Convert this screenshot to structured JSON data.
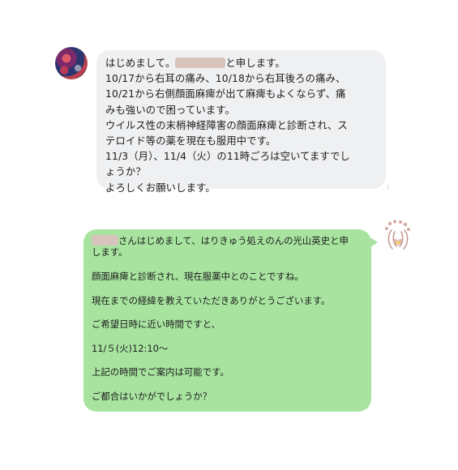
{
  "conversation": {
    "incoming": {
      "avatar_icon": "user-avatar-icon",
      "greeting_prefix": "はじめまして。",
      "greeting_suffix": "と申します。",
      "lines": [
        "10/17から右耳の痛み、10/18から右耳後ろの痛み、",
        "10/21から右側顔面麻痺が出て麻痺もよくならず、痛",
        "みも強いので困っています。",
        "ウイルス性の末梢神経障害の顔面麻痺と診断され、ス",
        "テロイド等の薬を現在も服用中です。",
        "11/3（月）、11/4（火）の11時ごろは空いてますでし",
        "ょうか？",
        "よろしくお願いします。"
      ]
    },
    "outgoing": {
      "avatar_icon": "clinic-logo-icon",
      "first_suffix_line1": "さんはじめまして、はりきゅう処えのんの光山英史と申",
      "first_line2": "します。",
      "paragraphs": [
        "顔面麻痺と診断され、現在服薬中とのことですね。",
        "現在までの経緯を教えていただきありがとうございます。",
        "ご希望日時に近い時間ですと、",
        "11/５(火)12:10〜",
        "上記の時間でご案内は可能です。",
        "ご都合はいかがでしょうか？"
      ]
    },
    "colors": {
      "incoming_bubble": "#eff0f2",
      "outgoing_bubble": "#a8e4a0",
      "redaction": "#d9c3bd"
    }
  }
}
